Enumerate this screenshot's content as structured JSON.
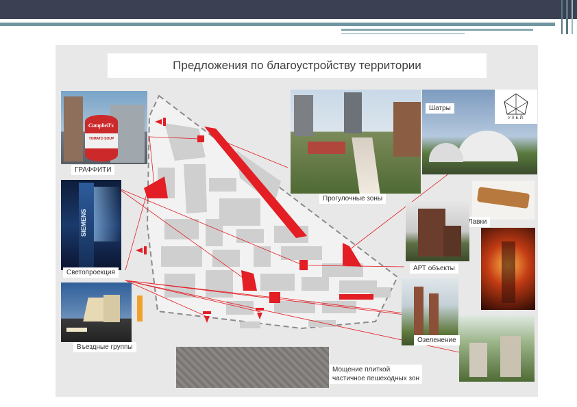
{
  "slide": {
    "title": "Предложения по благоустройству территории",
    "logo_text": "УЛЕЙ"
  },
  "labels": {
    "graffiti": "ГРАФФИТИ",
    "projection": "Светопроекция",
    "entrance": "Въездные группы",
    "walk_zones": "Прогулочные зоны",
    "tents": "Шатры",
    "benches": "Лавки",
    "art": "АРТ объекты",
    "greening": "Озеленение",
    "paving_line1": "Мощение плиткой",
    "paving_line2": "частичное пешеходных зон"
  },
  "photo_text": {
    "siemens": "SIEMENS",
    "campbells": "Campbell's",
    "tomato_soup": "TOMATO SOUP"
  },
  "colors": {
    "accent_red": "#e31e24",
    "header": "#3b4152",
    "teal": "#6f96a0"
  }
}
